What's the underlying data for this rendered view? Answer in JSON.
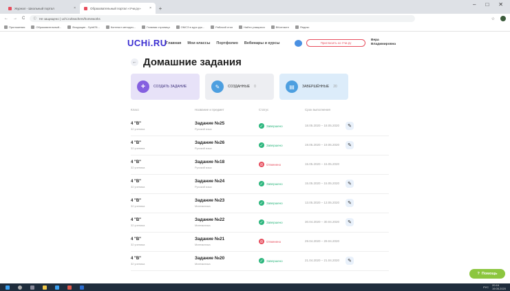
{
  "browser": {
    "tabs": [
      {
        "title": "Журнал - Школьный портал",
        "favicon_color": "#e74c5c",
        "active": false
      },
      {
        "title": "Образовательный портал «Учи.ру»",
        "favicon_color": "#e74c5c",
        "active": true
      }
    ],
    "new_tab": "+",
    "window_controls": [
      "–",
      "□",
      "✕"
    ],
    "nav_back": "←",
    "nav_forward": "→",
    "reload": "C",
    "url": "Не защищено | uchi.ru/teachers/homeworks",
    "bookmarks": [
      "Приложения",
      "Образовательный...",
      "Входящие - Spirit78...",
      "Контекст методич...",
      "Главная страница",
      "ОМСЗ в курс.рук...",
      "Рабочий стол",
      "Найти учащихся",
      "ВКонтакте",
      "Яндекс"
    ]
  },
  "site": {
    "logo": "UCHi.RU",
    "nav": [
      "Главная",
      "Мои классы",
      "Портфолио",
      "Вебинары и курсы"
    ],
    "invite_label": "Пригласить ко Учи.ру",
    "user_name_line1": "Вера",
    "user_name_line2": "Владимировна"
  },
  "page": {
    "back": "←",
    "title": "Домашние задания",
    "cards": {
      "create": {
        "icon": "+",
        "label": "СОЗДАТЬ ЗАДАНИЕ"
      },
      "created": {
        "label": "СОЗДАННЫЕ",
        "count": "0"
      },
      "done": {
        "label": "ЗАВЕРШЁННЫЕ",
        "count": "20"
      }
    },
    "columns": [
      "Класс",
      "Название и предмет",
      "Статус",
      "Срок выполнения"
    ],
    "rows": [
      {
        "class": "4 \"В\"",
        "pupils": "32 ученика",
        "task": "Задание №25",
        "subject": "Русский язык",
        "status": "Завершено",
        "status_type": "ok",
        "dates": "18.05.2020 – 18.05.2020",
        "editable": true
      },
      {
        "class": "4 \"В\"",
        "pupils": "32 ученика",
        "task": "Задание №26",
        "subject": "Русский язык",
        "status": "Завершено",
        "status_type": "ok",
        "dates": "19.05.2020 – 19.05.2020",
        "editable": true
      },
      {
        "class": "4 \"В\"",
        "pupils": "32 ученика",
        "task": "Задание №18",
        "subject": "Русский язык",
        "status": "Отменено",
        "status_type": "cancel",
        "dates": "15.05.2020 – 15.05.2020",
        "editable": false
      },
      {
        "class": "4 \"В\"",
        "pupils": "32 ученика",
        "task": "Задание №24",
        "subject": "Русский язык",
        "status": "Завершено",
        "status_type": "ok",
        "dates": "15.05.2020 – 15.05.2020",
        "editable": true
      },
      {
        "class": "4 \"В\"",
        "pupils": "32 ученика",
        "task": "Задание №23",
        "subject": "Математика",
        "status": "Завершено",
        "status_type": "ok",
        "dates": "13.05.2020 – 13.05.2020",
        "editable": true
      },
      {
        "class": "4 \"В\"",
        "pupils": "32 ученика",
        "task": "Задание №22",
        "subject": "Математика",
        "status": "Завершено",
        "status_type": "ok",
        "dates": "30.04.2020 – 30.04.2020",
        "editable": true
      },
      {
        "class": "4 \"В\"",
        "pupils": "32 ученика",
        "task": "Задание №21",
        "subject": "Математика",
        "status": "Отменено",
        "status_type": "cancel",
        "dates": "29.04.2020 – 29.04.2020",
        "editable": false
      },
      {
        "class": "4 \"В\"",
        "pupils": "32 ученика",
        "task": "Задание №20",
        "subject": "Математика",
        "status": "Завершено",
        "status_type": "ok",
        "dates": "21.04.2020 – 21.04.2020",
        "editable": true
      }
    ],
    "help_label": "Помощь"
  },
  "taskbar": {
    "tray_lang": "РУС",
    "time": "20:16",
    "date": "19.05.2020"
  },
  "colors": {
    "brand": "#3a2dd1",
    "ok": "#2cb67d",
    "cancel": "#e74c5c",
    "help": "#8cc63f"
  }
}
